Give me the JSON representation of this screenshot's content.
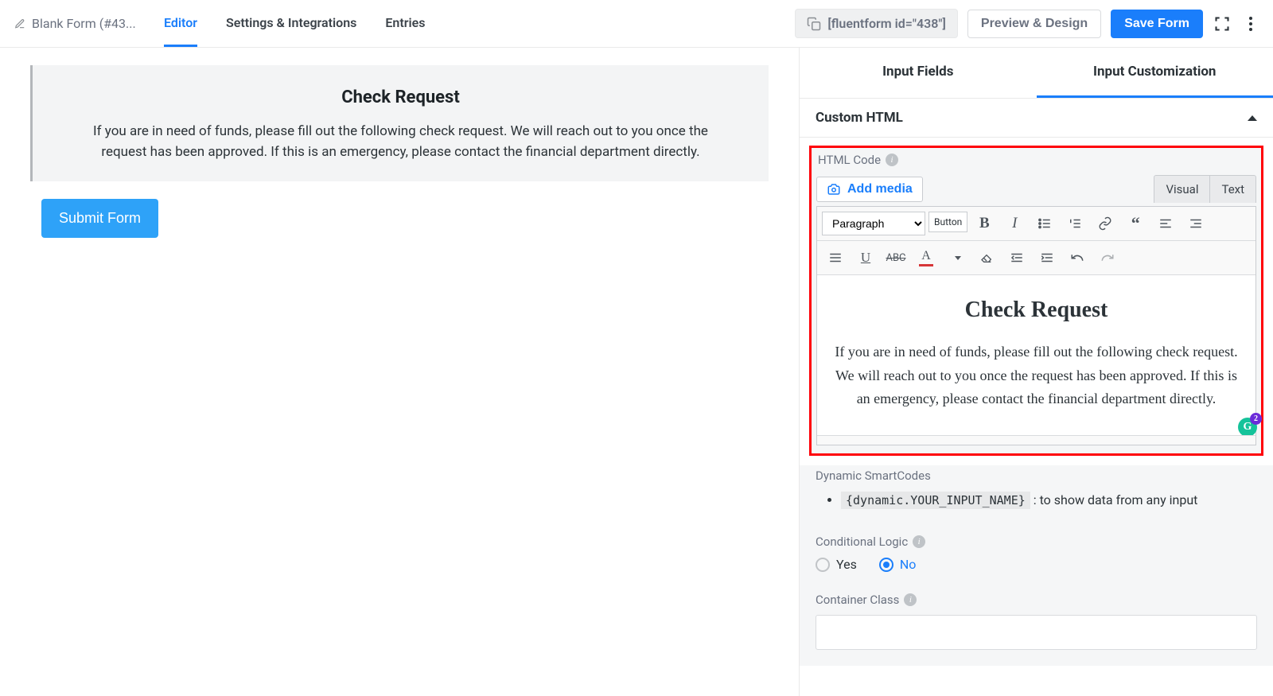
{
  "topbar": {
    "form_name": "Blank Form (#43...",
    "tabs": {
      "editor": "Editor",
      "settings": "Settings & Integrations",
      "entries": "Entries"
    },
    "shortcode": "[fluentform id=\"438\"]",
    "preview_label": "Preview & Design",
    "save_label": "Save Form"
  },
  "canvas": {
    "title": "Check Request",
    "desc": "If you are in need of funds, please fill out the following check request. We will reach out to you once the request has been approved. If this is an emergency, please contact the financial department directly.",
    "submit_label": "Submit Form"
  },
  "panel": {
    "tab_input_fields": "Input Fields",
    "tab_input_custom": "Input Customization",
    "section_custom_html": "Custom HTML",
    "html_code_label": "HTML Code",
    "add_media_label": "Add media",
    "mode_visual": "Visual",
    "mode_text": "Text",
    "paragraph_option": "Paragraph",
    "button_chip": "Button",
    "editor_heading": "Check Request",
    "editor_para": "If you are in need of funds, please fill out the following check request. We will reach out to you once the request has been approved. If this is an emergency, please contact the financial department directly.",
    "grammarly_count": "2",
    "dynamic_smartcodes_label": "Dynamic SmartCodes",
    "smartcode_example": "{dynamic.YOUR_INPUT_NAME}",
    "smartcode_hint": ": to show data from any input",
    "cond_logic_label": "Conditional Logic",
    "radio_yes": "Yes",
    "radio_no": "No",
    "container_class_label": "Container Class"
  }
}
